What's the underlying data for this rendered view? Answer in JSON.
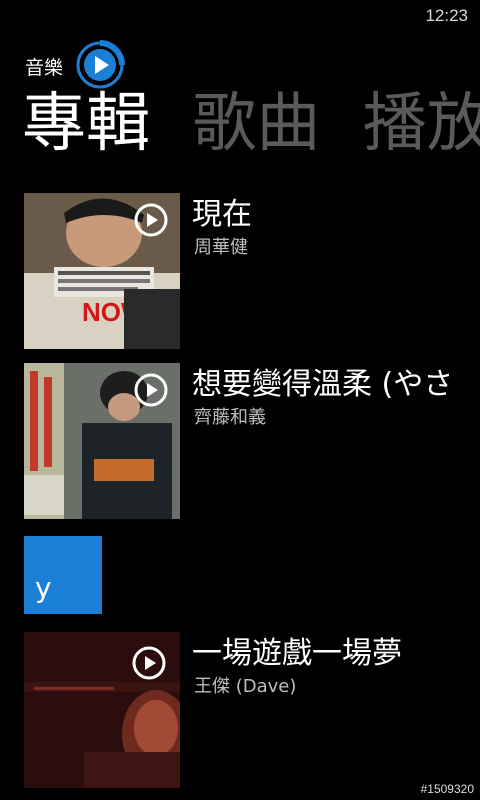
{
  "status": {
    "time": "12:23"
  },
  "app": {
    "title": "音樂"
  },
  "pivot": {
    "tabs": [
      "專輯",
      "歌曲",
      "播放"
    ]
  },
  "albums": [
    {
      "title": "現在",
      "artist": "周華健",
      "cover_text": "NOW"
    },
    {
      "title": "想要變得溫柔 (やさ",
      "artist": "齊藤和義"
    },
    {
      "title": "一場遊戲一場夢",
      "artist": "王傑 (Dave)"
    }
  ],
  "jump_tile": {
    "letter": "y"
  },
  "watermark": "#1509320",
  "colors": {
    "accent": "#1c7fd6",
    "inactive": "#5a5a5a",
    "subtext": "#bdbdbd"
  }
}
